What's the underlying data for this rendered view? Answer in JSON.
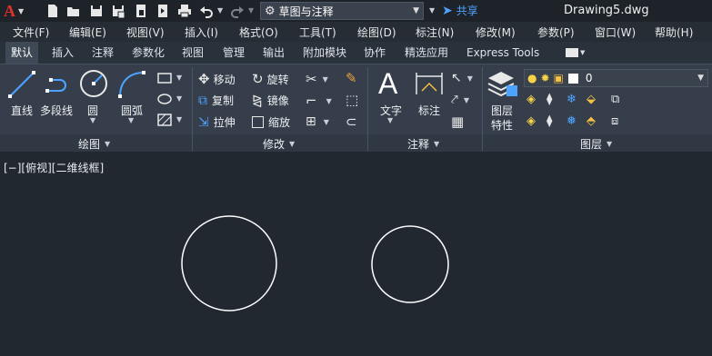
{
  "titlebar": {
    "logo": "A",
    "workspace": "草图与注释",
    "share": "共享",
    "filename": "Drawing5.dwg",
    "icons": [
      "new-icon",
      "open-icon",
      "save-icon",
      "saveas-icon",
      "open-web-icon",
      "save-web-icon",
      "plot-icon",
      "undo-icon",
      "redo-icon"
    ]
  },
  "menu": [
    "文件(F)",
    "编辑(E)",
    "视图(V)",
    "插入(I)",
    "格式(O)",
    "工具(T)",
    "绘图(D)",
    "标注(N)",
    "修改(M)",
    "参数(P)",
    "窗口(W)",
    "帮助(H)"
  ],
  "tabs": [
    "默认",
    "插入",
    "注释",
    "参数化",
    "视图",
    "管理",
    "输出",
    "附加模块",
    "协作",
    "精选应用",
    "Express Tools"
  ],
  "active_tab": "默认",
  "draw_panel": {
    "title": "绘图",
    "tools": [
      "直线",
      "多段线",
      "圆",
      "圆弧"
    ]
  },
  "modify_panel": {
    "title": "修改",
    "tools": [
      "移动",
      "旋转",
      "复制",
      "镜像",
      "拉伸",
      "缩放"
    ]
  },
  "annotation_panel": {
    "title": "注释",
    "tools": [
      "文字",
      "标注"
    ]
  },
  "layer_panel": {
    "title": "图层",
    "properties": "图层\n特性",
    "properties_l1": "图层",
    "properties_l2": "特性",
    "current_layer": "0"
  },
  "viewport": {
    "label": "[−][俯视][二维线框]"
  },
  "colors": {
    "canvas": "#212830",
    "ribbon": "#353e4a",
    "accent_blue": "#4da3ff",
    "logo_red": "#e0322c"
  }
}
